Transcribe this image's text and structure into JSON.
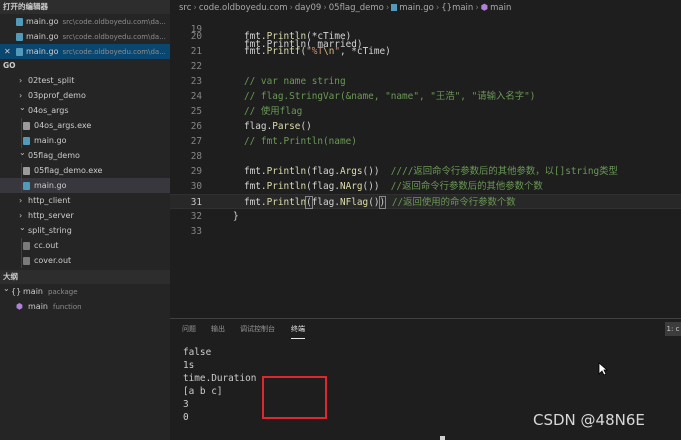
{
  "sidebar": {
    "open_editors_title": "打开的编辑器",
    "open_editors": [
      {
        "name": "main.go",
        "path": "src\\code.oldboyedu.com\\da...",
        "active": false
      },
      {
        "name": "main.go",
        "path": "src\\code.oldboyedu.com\\da...",
        "active": false
      },
      {
        "name": "main.go",
        "path": "src\\code.oldboyedu.com\\da...",
        "active": true
      }
    ],
    "close_glyph": "✕",
    "workspace_title": "GO",
    "tree": [
      {
        "label": "02test_split",
        "type": "folder",
        "state": "collapsed"
      },
      {
        "label": "03pprof_demo",
        "type": "folder",
        "state": "collapsed"
      },
      {
        "label": "04os_args",
        "type": "folder",
        "state": "expanded"
      },
      {
        "label": "04os_args.exe",
        "type": "exe"
      },
      {
        "label": "main.go",
        "type": "go"
      },
      {
        "label": "05flag_demo",
        "type": "folder",
        "state": "expanded"
      },
      {
        "label": "05flag_demo.exe",
        "type": "exe"
      },
      {
        "label": "main.go",
        "type": "go",
        "selected": true
      },
      {
        "label": "http_client",
        "type": "folder",
        "state": "collapsed"
      },
      {
        "label": "http_server",
        "type": "folder",
        "state": "collapsed"
      },
      {
        "label": "split_string",
        "type": "folder",
        "state": "expanded"
      },
      {
        "label": "cc.out",
        "type": "out"
      },
      {
        "label": "cover.out",
        "type": "out"
      }
    ],
    "outline_title": "大纲",
    "outline": [
      {
        "label": "main",
        "kind": "package"
      },
      {
        "label": "main",
        "kind": "function"
      }
    ]
  },
  "breadcrumb": [
    "src",
    "code.oldboyedu.com",
    "day09",
    "05flag_demo",
    "main.go",
    "{}main",
    "main"
  ],
  "editor": {
    "top_partial": "fmt.Println( married)",
    "lines": [
      {
        "n": "20",
        "parts": [
          [
            "p",
            "fmt."
          ],
          [
            "f",
            "Println"
          ],
          [
            "p",
            "(*cTime)"
          ]
        ]
      },
      {
        "n": "21",
        "parts": [
          [
            "p",
            "fmt."
          ],
          [
            "f",
            "Printf"
          ],
          [
            "p",
            "("
          ],
          [
            "s",
            "\"%T"
          ],
          [
            "e",
            "\\n"
          ],
          [
            "s",
            "\""
          ],
          [
            "p",
            ", *cTime)"
          ]
        ]
      },
      {
        "n": "22",
        "parts": []
      },
      {
        "n": "23",
        "parts": [
          [
            "c",
            "// var name string"
          ]
        ]
      },
      {
        "n": "24",
        "parts": [
          [
            "c",
            "// flag.StringVar(&name, \"name\", \"王浩\", \"请输入名字\")"
          ]
        ]
      },
      {
        "n": "25",
        "parts": [
          [
            "c",
            "// 使用flag"
          ]
        ]
      },
      {
        "n": "26",
        "parts": [
          [
            "p",
            "flag."
          ],
          [
            "f",
            "Parse"
          ],
          [
            "p",
            "()"
          ]
        ]
      },
      {
        "n": "27",
        "parts": [
          [
            "c",
            "// fmt.Println(name)"
          ]
        ]
      },
      {
        "n": "28",
        "parts": []
      },
      {
        "n": "29",
        "parts": [
          [
            "p",
            "fmt."
          ],
          [
            "f",
            "Println"
          ],
          [
            "p",
            "(flag."
          ],
          [
            "f",
            "Args"
          ],
          [
            "p",
            "())  "
          ],
          [
            "c",
            "////返回命令行参数后的其他参数，以[]string类型"
          ]
        ]
      },
      {
        "n": "30",
        "parts": [
          [
            "p",
            "fmt."
          ],
          [
            "f",
            "Println"
          ],
          [
            "p",
            "(flag."
          ],
          [
            "f",
            "NArg"
          ],
          [
            "p",
            "())  "
          ],
          [
            "c",
            "//返回命令行参数后的其他参数个数"
          ]
        ]
      },
      {
        "n": "31",
        "parts": [
          [
            "p",
            "fmt."
          ],
          [
            "f",
            "Println"
          ],
          [
            "b",
            "("
          ],
          [
            "p",
            "flag."
          ],
          [
            "f",
            "NFlag"
          ],
          [
            "p",
            "()"
          ],
          [
            "b",
            ")"
          ],
          [
            "k",
            ""
          ],
          [
            "p",
            " "
          ],
          [
            "c",
            "//返回使用的命令行参数个数"
          ]
        ]
      },
      {
        "n": "32",
        "parts": [
          [
            "p",
            "}"
          ]
        ]
      },
      {
        "n": "33",
        "parts": []
      }
    ]
  },
  "panel": {
    "tabs": [
      "问题",
      "输出",
      "调试控制台",
      "终端"
    ],
    "active_tab": "终端",
    "terminal_selector": "1: c",
    "output": [
      "false",
      "1s",
      "time.Duration",
      "[a b c]",
      "3",
      "0"
    ]
  },
  "watermark": "CSDN @48N6E",
  "colors": {
    "highlight_box": "#e0262f",
    "selection": "#094771",
    "comment": "#6a9955",
    "function": "#dcdcaa",
    "string": "#ce9178"
  }
}
